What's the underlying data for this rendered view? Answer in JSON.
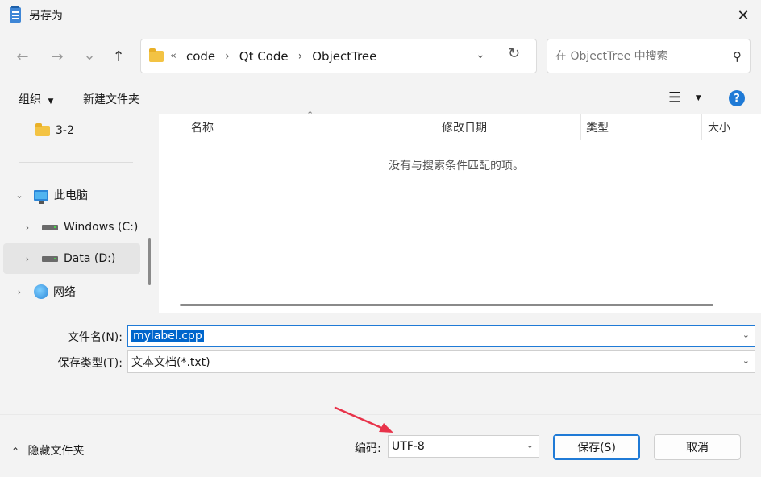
{
  "window": {
    "title": "另存为",
    "close_glyph": "✕"
  },
  "nav": {
    "back_glyph": "←",
    "forward_glyph": "→",
    "recent_glyph": "⌄",
    "up_glyph": "↑",
    "breadcrumb": [
      "code",
      "Qt Code",
      "ObjectTree"
    ],
    "breadcrumb_overflow": "«",
    "refresh_glyph": "↻",
    "search_placeholder": "在 ObjectTree 中搜索"
  },
  "toolbar": {
    "organize_label": "组织",
    "new_folder_label": "新建文件夹",
    "help_glyph": "?"
  },
  "sidebar": {
    "items": [
      {
        "label": "3-2",
        "icon": "folder-icon"
      },
      {
        "label": "此电脑",
        "icon": "computer-icon"
      },
      {
        "label": "Windows (C:)",
        "icon": "drive-icon"
      },
      {
        "label": "Data (D:)",
        "icon": "drive-icon"
      },
      {
        "label": "网络",
        "icon": "network-icon"
      }
    ]
  },
  "file_list": {
    "columns": [
      "名称",
      "修改日期",
      "类型",
      "大小"
    ],
    "empty_message": "没有与搜索条件匹配的项。"
  },
  "form": {
    "filename_label": "文件名(N):",
    "filename_value": "mylabel.cpp",
    "filetype_label": "保存类型(T):",
    "filetype_value": "文本文档(*.txt)"
  },
  "footer": {
    "hide_folders_label": "隐藏文件夹",
    "encoding_label": "编码:",
    "encoding_value": "UTF-8",
    "save_label": "保存(S)",
    "cancel_label": "取消"
  },
  "colors": {
    "accent": "#1f7ad6",
    "annotation_arrow": "#e8334a"
  }
}
